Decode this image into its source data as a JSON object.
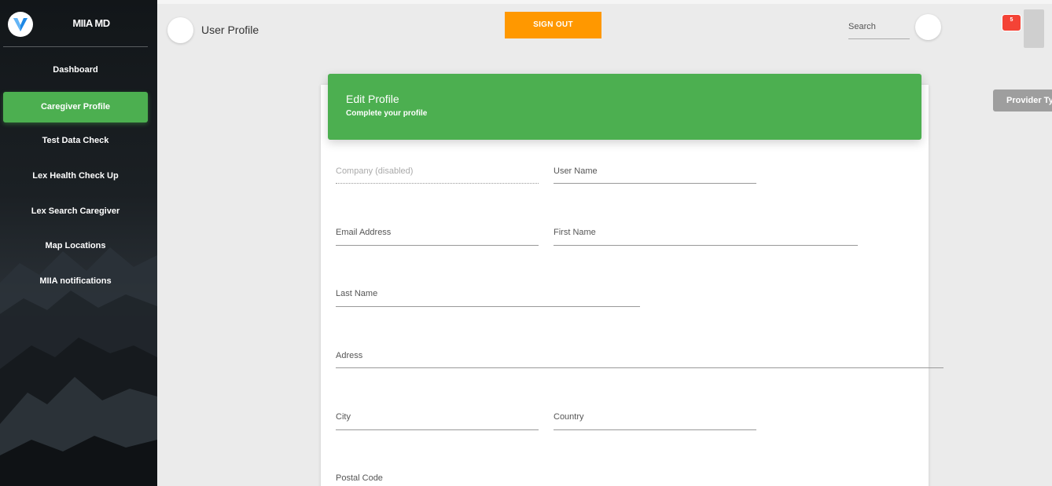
{
  "sidebar": {
    "brand": "MIIA MD",
    "items": [
      {
        "label": "Dashboard"
      },
      {
        "label": "Caregiver Profile"
      },
      {
        "label": "Test Data Check"
      },
      {
        "label": "Lex Health Check Up"
      },
      {
        "label": "Lex Search Caregiver"
      },
      {
        "label": "Map Locations"
      },
      {
        "label": "MIIA notifications"
      }
    ],
    "active_index": 1
  },
  "header": {
    "title": "User Profile",
    "signout_label": "SIGN OUT",
    "search_placeholder": "Search",
    "notification_count": "5"
  },
  "card": {
    "title": "Edit Profile",
    "subtitle": "Complete your profile",
    "fields": {
      "company": "Company (disabled)",
      "username": "User Name",
      "email": "Email Address",
      "first_name": "First Name",
      "last_name": "Last Name",
      "address": "Adress",
      "city": "City",
      "country": "Country",
      "postal_code": "Postal Code"
    }
  },
  "provider_button": "Provider Type",
  "colors": {
    "accent_green": "#4caf50",
    "signout_orange": "#ff9800",
    "badge_red": "#f44336",
    "sidebar_dark": "#1b2024"
  },
  "icons": [
    "menu-icon",
    "search-icon",
    "notifications-icon",
    "logo-icon"
  ]
}
